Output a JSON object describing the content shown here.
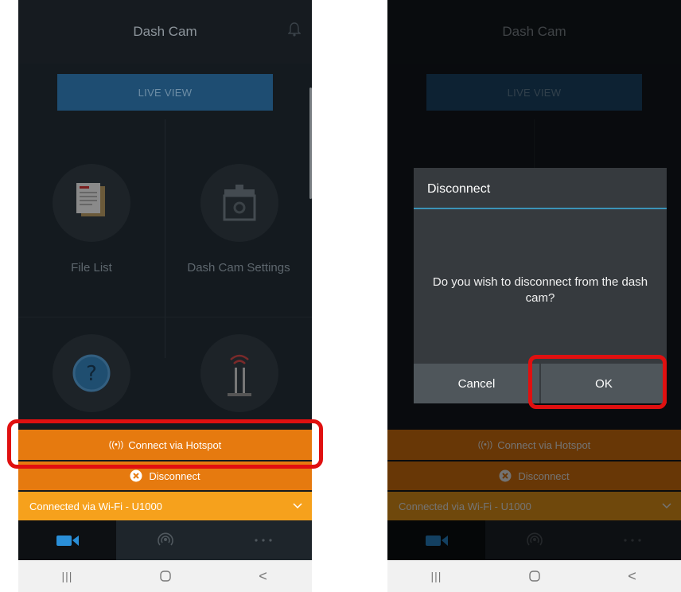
{
  "header": {
    "title": "Dash Cam"
  },
  "live_view_label": "LIVE VIEW",
  "tiles": [
    {
      "label": "File List",
      "icon": "file-list-icon"
    },
    {
      "label": "Dash Cam Settings",
      "icon": "dashcam-settings-icon"
    },
    {
      "label": "",
      "icon": "help-icon"
    },
    {
      "label": "",
      "icon": "router-icon"
    }
  ],
  "actions": {
    "hotspot_label": "Connect via Hotspot",
    "disconnect_label": "Disconnect"
  },
  "connection": {
    "status_label": "Connected via Wi-Fi - ",
    "network": "U1000"
  },
  "bottom_nav": [
    {
      "icon": "camera-icon",
      "active": true
    },
    {
      "icon": "hotspot-icon",
      "active": false
    },
    {
      "icon": "more-icon",
      "active": false
    }
  ],
  "system_nav": {
    "recents": "|||",
    "back": "<"
  },
  "dialog": {
    "title": "Disconnect",
    "message": "Do you wish to disconnect from the dash cam?",
    "cancel_label": "Cancel",
    "ok_label": "OK"
  },
  "colors": {
    "accent_orange": "#e67a0f",
    "status_orange": "#f6a11c",
    "highlight_red": "#e01010",
    "dialog_divider": "#3b93b8"
  }
}
